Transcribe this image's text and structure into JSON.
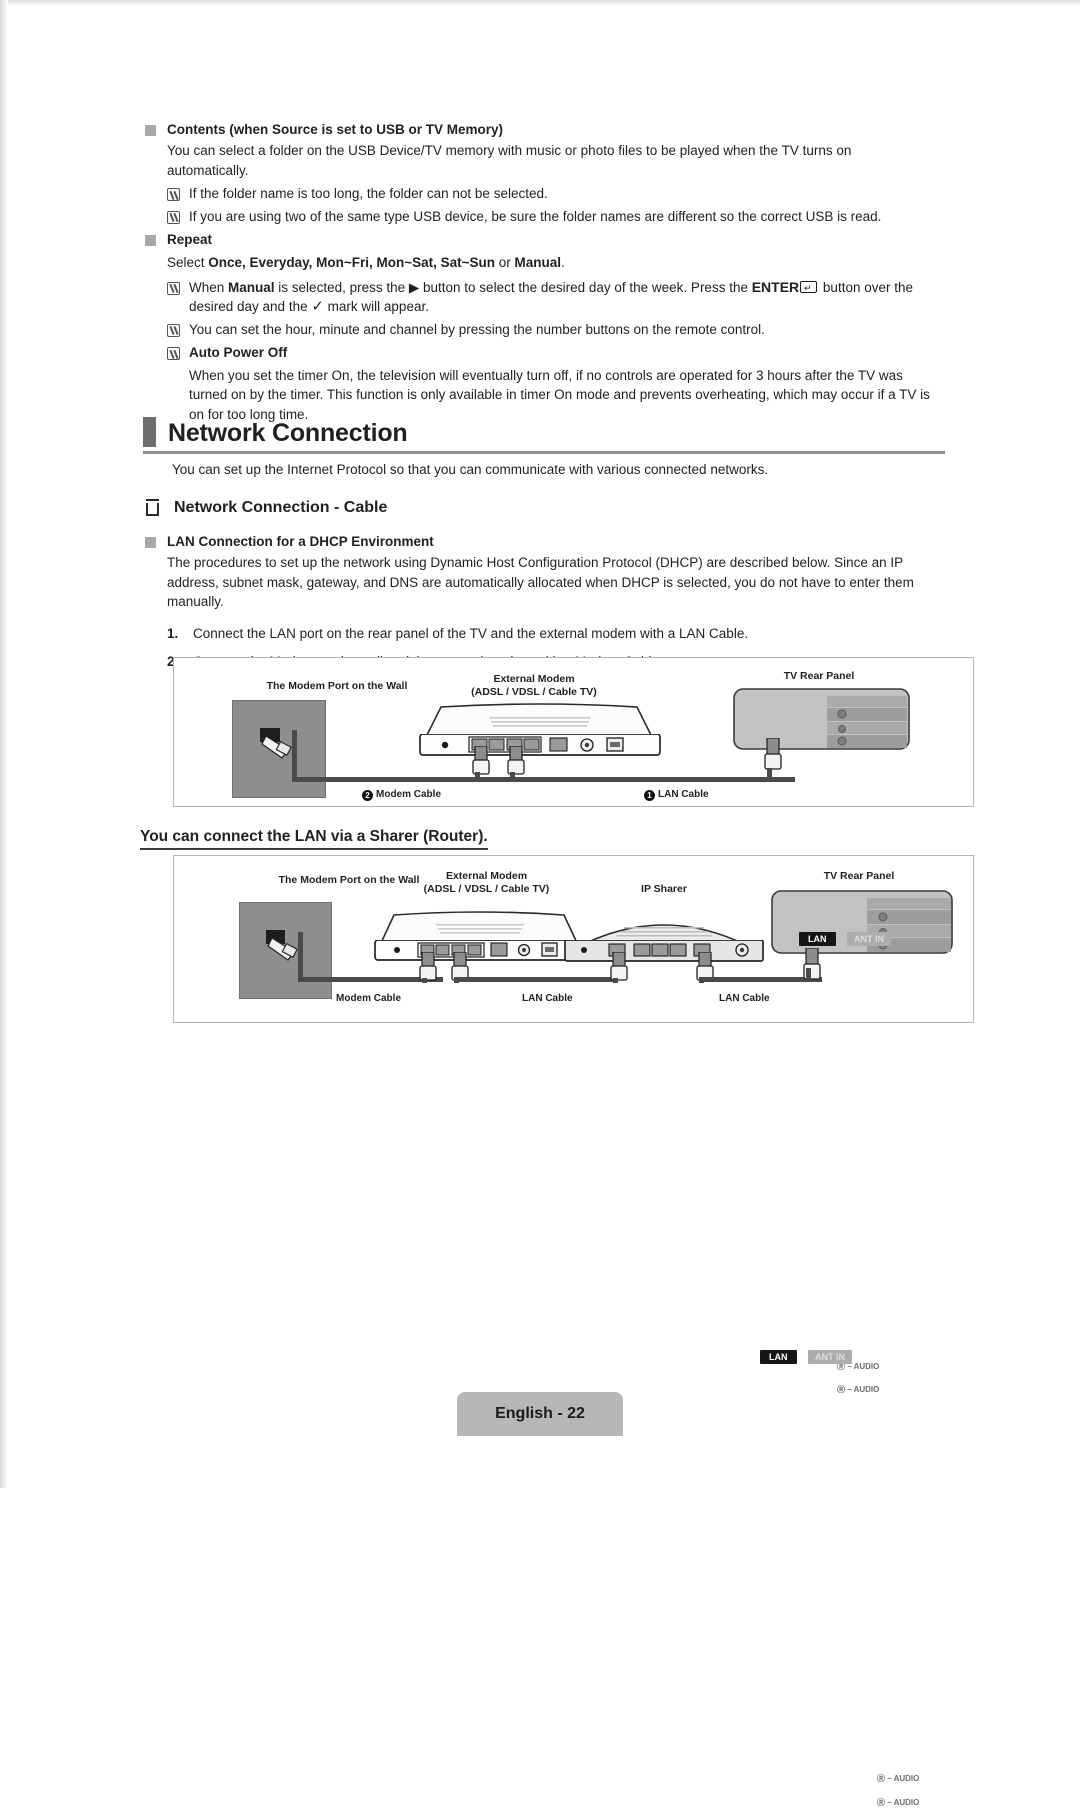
{
  "document": {
    "page_label": "English - 22"
  },
  "contents_section": {
    "heading": "Contents (when Source is set to USB or TV Memory)",
    "paragraph": "You can select a folder on the USB Device/TV memory with music or photo files to be played when the TV turns on automatically.",
    "notes": [
      "If the folder name is too long, the folder can not be selected.",
      "If you are using two of the same type USB device, be sure the folder names are different so the correct USB is read."
    ]
  },
  "repeat_section": {
    "heading": "Repeat",
    "select_line_prefix": "Select ",
    "select_line_options": "Once, Everyday, Mon~Fri, Mon~Sat, Sat~Sun",
    "select_line_mid": " or ",
    "select_line_manual": "Manual",
    "select_line_suffix": ".",
    "note1_a": "When ",
    "note1_manual": "Manual",
    "note1_b": " is selected, press the ",
    "note1_arrow": "▶",
    "note1_c": " button to select the desired day of the week. Press the ",
    "note1_enter": "ENTER",
    "note1_d": " button over the desired day and the ",
    "note1_check": "✓",
    "note1_e": " mark will appear.",
    "note2": "You can set the hour, minute and channel by pressing the number buttons on the remote control.",
    "note3_heading": "Auto Power Off",
    "auto_power_off_body": "When you set the timer On, the television will eventually turn off, if no controls are operated for 3 hours after the TV was turned on by the timer. This function is only available in timer On mode and prevents overheating, which may occur if a TV is on for too long time."
  },
  "network_chapter": {
    "title": "Network Connection",
    "intro": "You can set up the Internet Protocol so that you can communicate with various connected networks.",
    "subsection_title": "Network Connection - Cable",
    "dhcp_heading": "LAN Connection for a DHCP Environment",
    "dhcp_paragraph": "The procedures to set up the network using Dynamic Host Configuration Protocol (DHCP) are described below. Since an IP address, subnet mask, gateway, and DNS are automatically allocated when DHCP is selected, you do not have to enter them manually.",
    "steps": [
      {
        "num": "1.",
        "text": "Connect the LAN port on the rear panel of the TV and the external modem with a LAN Cable."
      },
      {
        "num": "2.",
        "text": "Connect the Modem on the wall and the external modem with a Modem Cable."
      }
    ]
  },
  "diagram_cable": {
    "wall_label": "The Modem Port on the Wall",
    "modem_label_line1": "External Modem",
    "modem_label_line2": "(ADSL / VDSL / Cable TV)",
    "tv_label": "TV Rear Panel",
    "tv_ports": {
      "lan": "LAN",
      "ant": "ANT IN",
      "audio_r": "Ⓡ – AUDIO",
      "audio_l": "Ⓡ – AUDIO"
    },
    "cable_modem_num": "2",
    "cable_modem_label": "Modem Cable",
    "cable_lan_num": "1",
    "cable_lan_label": "LAN Cable"
  },
  "sharer_section": {
    "heading": "You can connect the LAN via a Sharer (Router)."
  },
  "diagram_sharer": {
    "wall_label": "The Modem Port on the Wall",
    "modem_label_line1": "External Modem",
    "modem_label_line2": "(ADSL / VDSL / Cable TV)",
    "sharer_label": "IP Sharer",
    "tv_label": "TV Rear Panel",
    "tv_ports": {
      "lan": "LAN",
      "ant": "ANT IN",
      "audio_r": "Ⓡ – AUDIO",
      "audio_l": "Ⓡ – AUDIO"
    },
    "cable1_label": "Modem Cable",
    "cable2_label": "LAN Cable",
    "cable3_label": "LAN Cable"
  },
  "colors": {
    "text": "#231f20",
    "marker_gray": "#a8a8a8",
    "chapter_bar": "#6d6d6d",
    "rule": "#8e8e8e",
    "wall": "#8e8e8e",
    "cable": "#4a4a4a",
    "footer_pill": "#b7b7b7"
  }
}
